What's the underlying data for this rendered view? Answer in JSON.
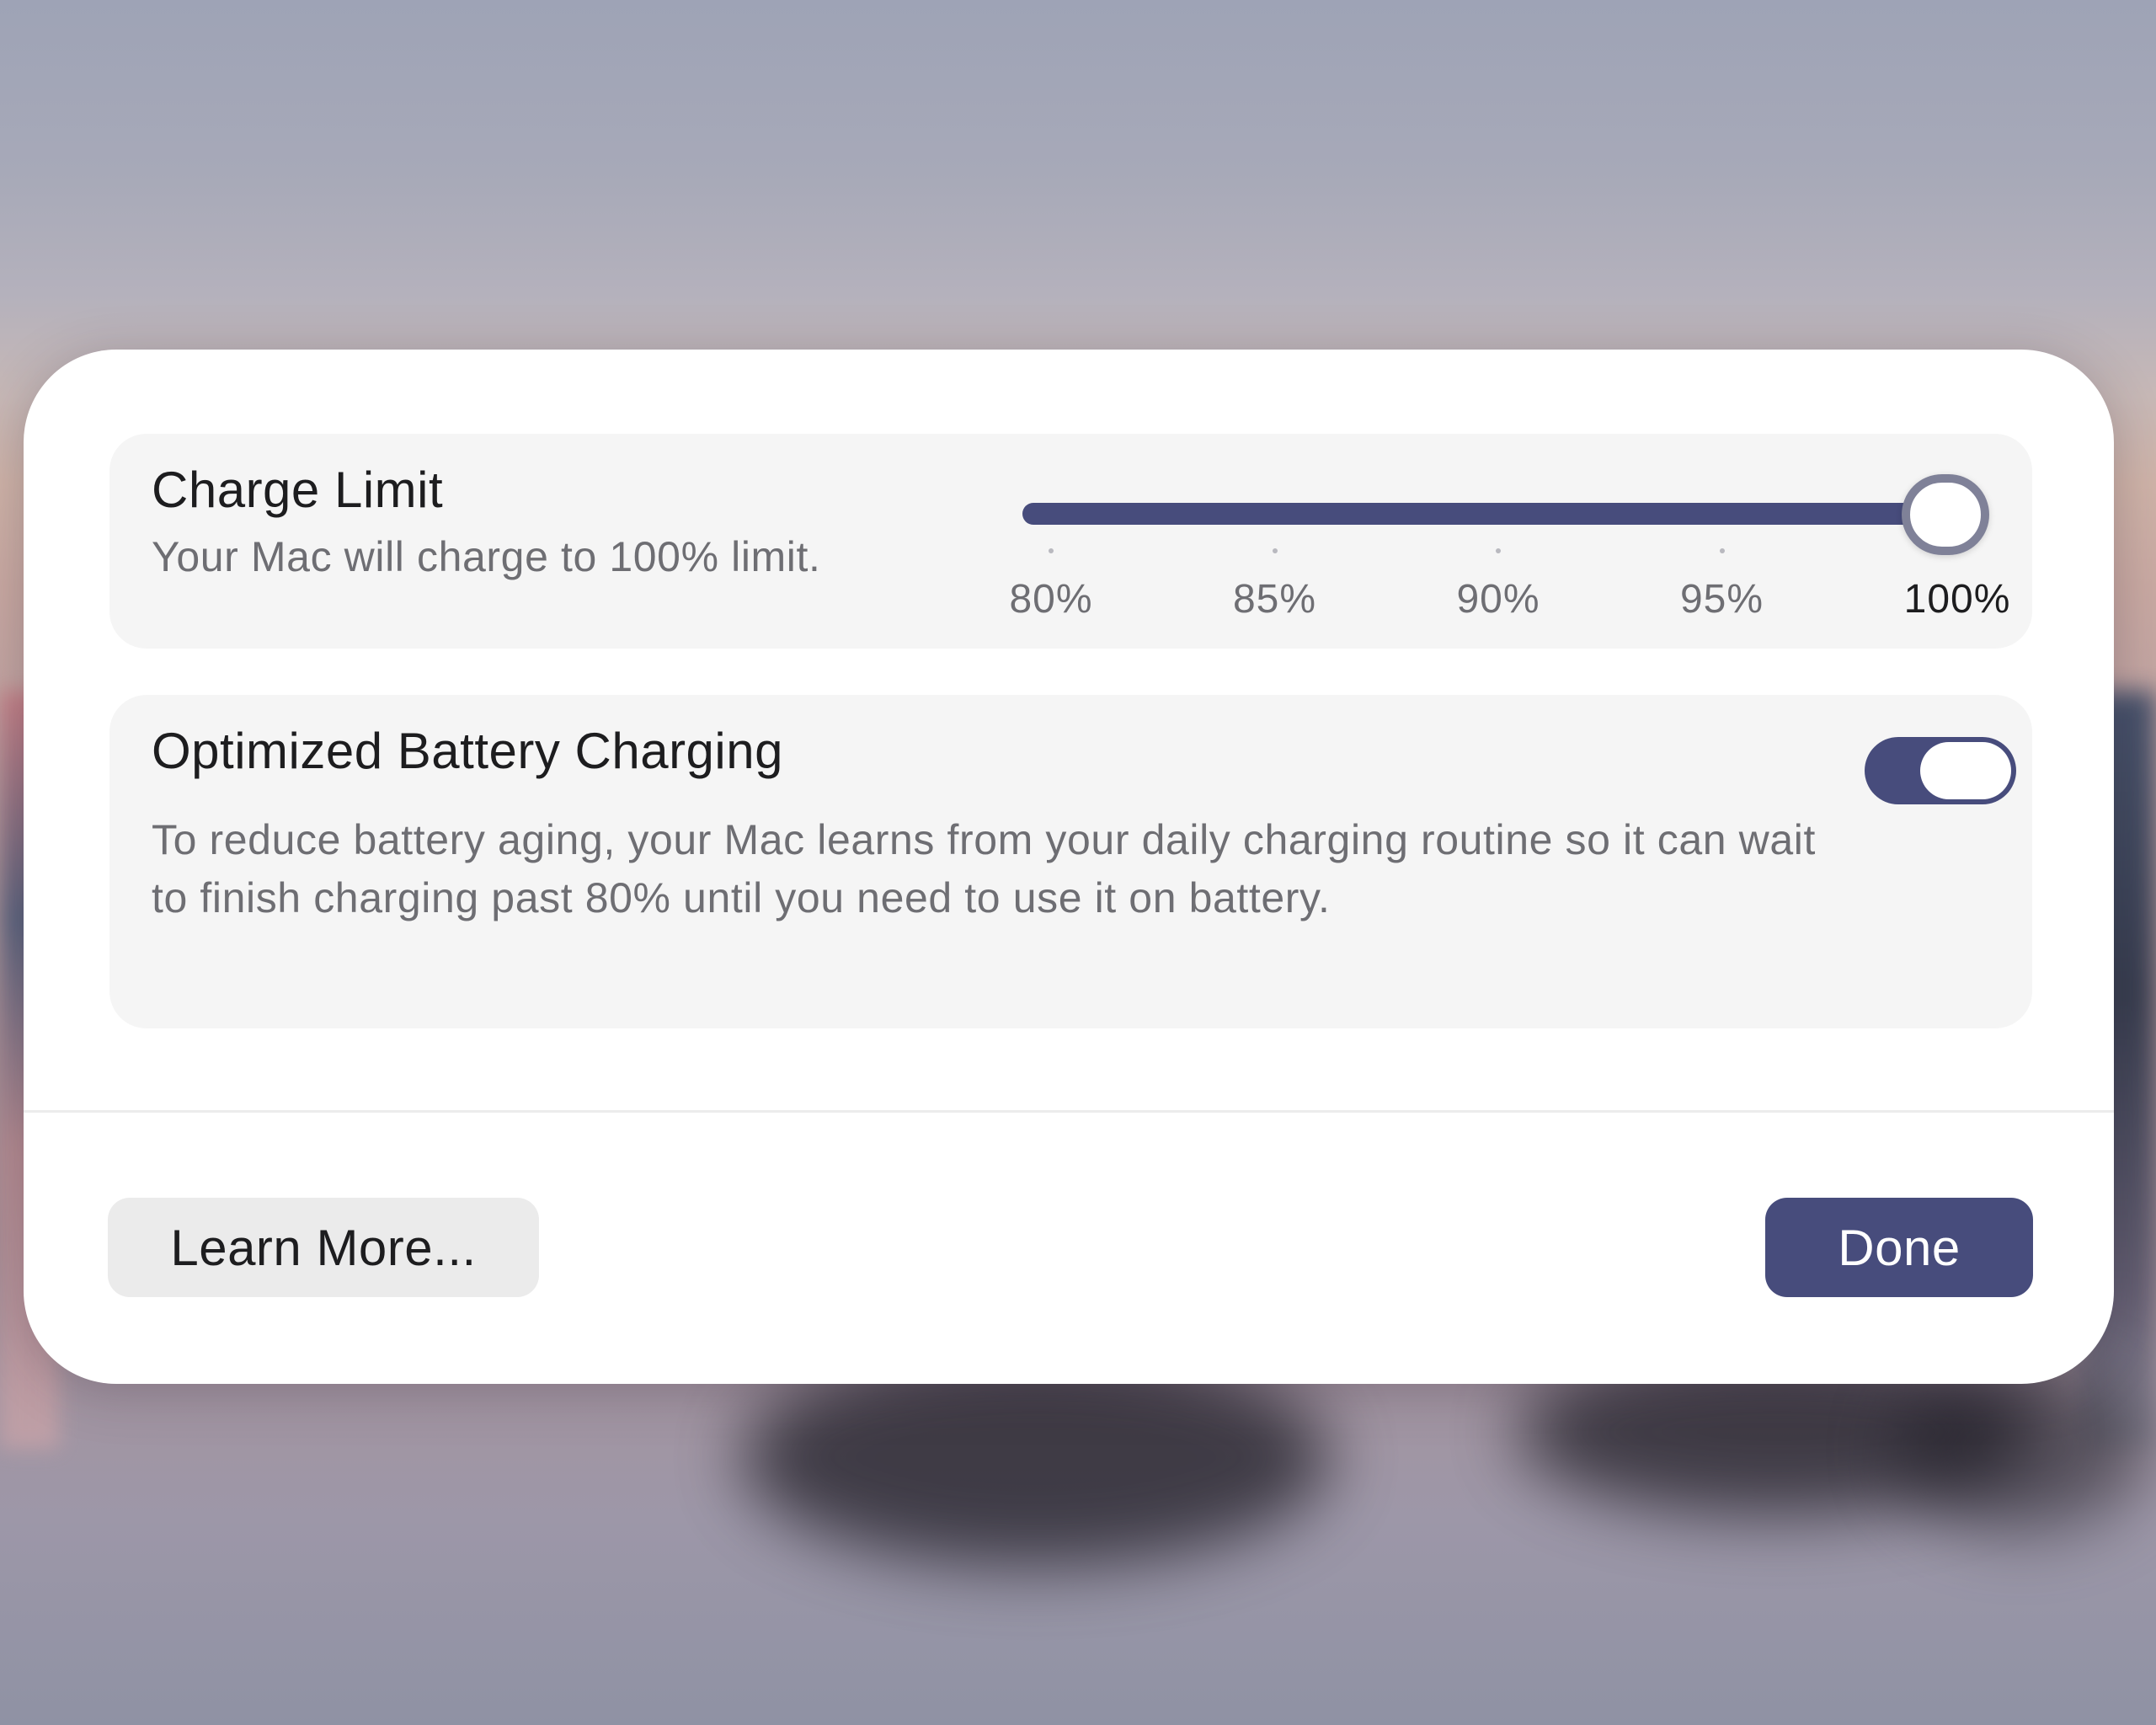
{
  "charge_limit": {
    "title": "Charge Limit",
    "subtitle": "Your Mac will charge to 100% limit.",
    "slider": {
      "ticks": [
        "80%",
        "85%",
        "90%",
        "95%",
        "100%"
      ],
      "selected_index": 4,
      "value_fraction": 1.0
    }
  },
  "optimized_charging": {
    "title": "Optimized Battery Charging",
    "description": "To reduce battery aging, your Mac learns from your daily charging routine so it can wait to finish charging past 80% until you need to use it on battery.",
    "enabled": true
  },
  "buttons": {
    "learn_more": "Learn More...",
    "done": "Done"
  },
  "colors": {
    "accent": "#474c7c",
    "card_bg": "#f5f5f5",
    "secondary_text": "#6e6e73"
  }
}
